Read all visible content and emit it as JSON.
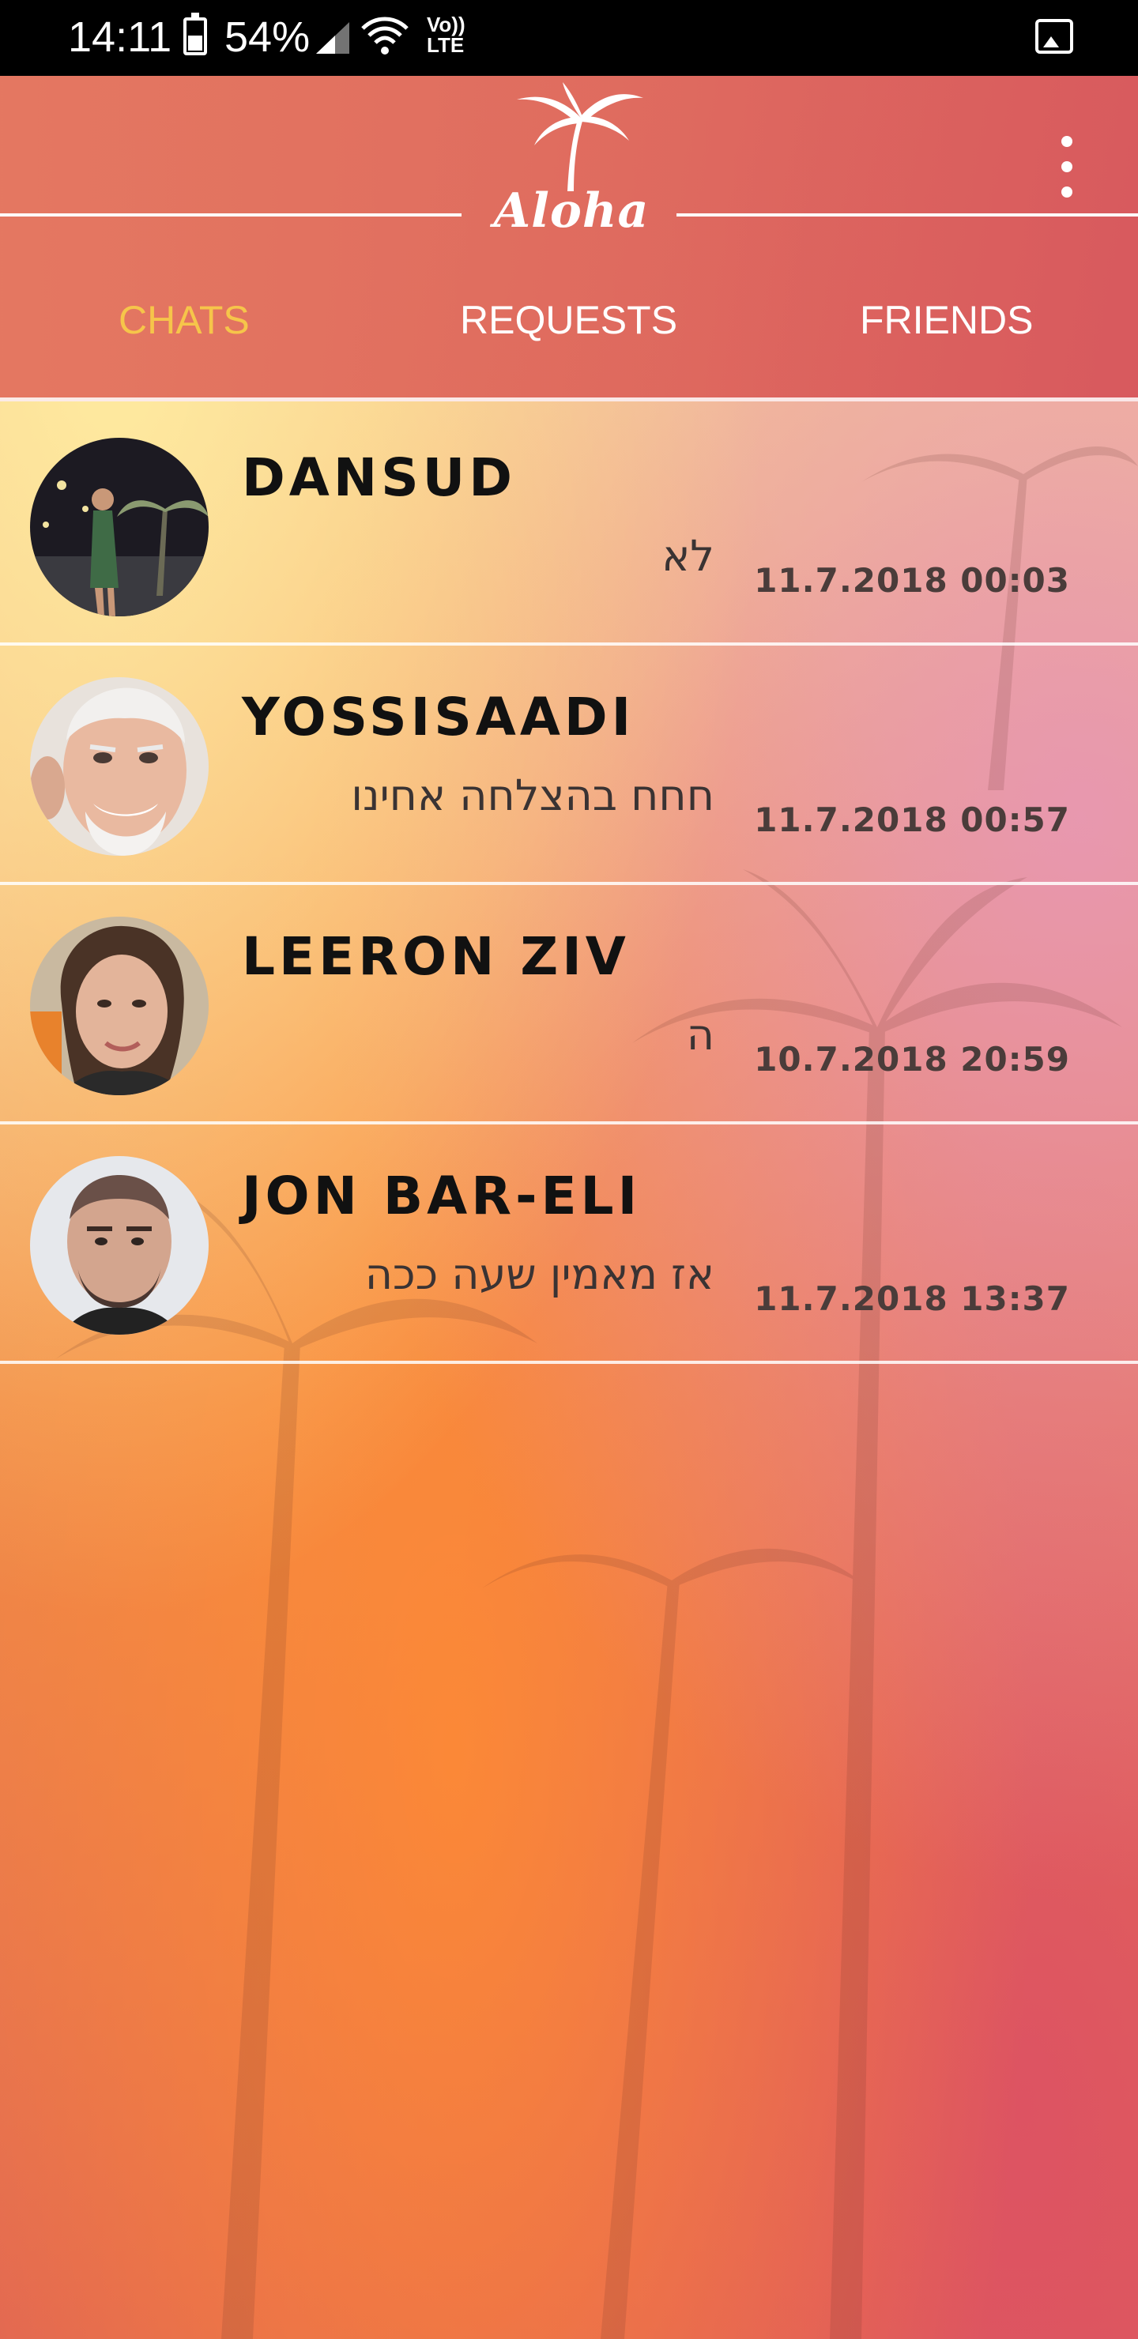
{
  "status_bar": {
    "time": "14:11",
    "battery": "54%",
    "network": "Vo)) LTE",
    "icons": [
      "battery-icon",
      "signal-icon",
      "wifi-icon",
      "gallery-icon"
    ]
  },
  "header": {
    "logo_text": "Aloha",
    "menu_icon": "more-vert-icon",
    "tabs": [
      {
        "label": "CHATS",
        "active": true
      },
      {
        "label": "REQUESTS",
        "active": false
      },
      {
        "label": "FRIENDS",
        "active": false
      }
    ]
  },
  "chats": [
    {
      "name": "DANSUD",
      "message": "לא",
      "timestamp": "11.7.2018 00:03"
    },
    {
      "name": "YOSSISAADI",
      "message": "חחח בהצלחה אחינו",
      "timestamp": "11.7.2018 00:57"
    },
    {
      "name": "LEERON ZIV",
      "message": "ה",
      "timestamp": "10.7.2018 20:59"
    },
    {
      "name": "JON BAR-ELI",
      "message": "אז מאמין שעה ככה",
      "timestamp": "11.7.2018 13:37"
    }
  ],
  "colors": {
    "active_tab": "#f6c54a",
    "header": "#dc5f58",
    "text": "#111111"
  }
}
